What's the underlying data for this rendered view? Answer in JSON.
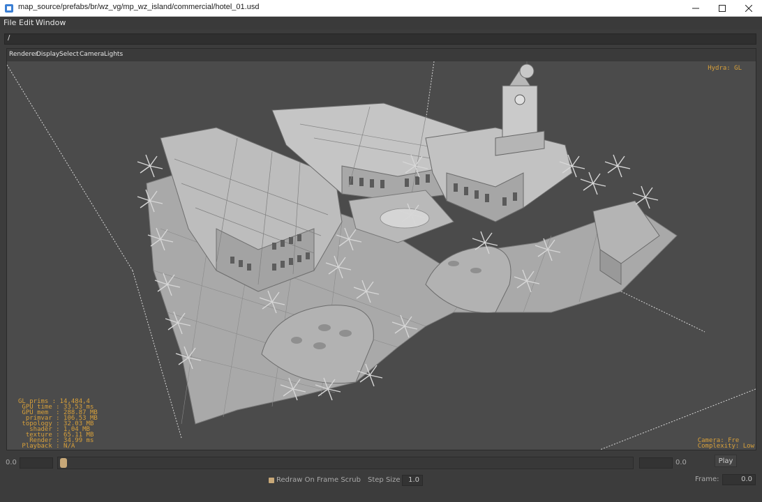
{
  "window": {
    "title": "map_source/prefabs/br/wz_vg/mp_wz_island/commercial/hotel_01.usd"
  },
  "menubar": {
    "file": "File",
    "edit": "Edit",
    "window": "Window"
  },
  "path": {
    "value": "/"
  },
  "viewer_menu": {
    "renderer": "Renderer",
    "display": "Display",
    "select": "Select",
    "camera": "Camera",
    "lights": "Lights"
  },
  "hud": {
    "renderer": "Hydra: GL",
    "stats": "GL prims : 14,484,4\n GPU time : 33.53 ms\n GPU mem  : 288.87 MB\n  primvar : 106.53 MB\n topology : 32.03 MB\n   shader : 1.04 MB\n  texture : 65.11 MB\n   Render : 34.99 ms\n Playback : N/A",
    "camera": "Camera: Fre\nComplexity: Low"
  },
  "playback": {
    "start_label": "0.0",
    "end_label": "0.0",
    "play_label": "Play",
    "redraw_label": "Redraw On Frame Scrub",
    "redraw_checked": true,
    "step_size_label": "Step Size",
    "step_size_value": "1.0",
    "frame_label": "Frame:",
    "frame_value": "0.0",
    "slider_position": 0
  },
  "colors": {
    "hud_text": "#d8a03a",
    "slider_handle": "#c8a878",
    "viewport_bg": "#4b4b4b"
  }
}
